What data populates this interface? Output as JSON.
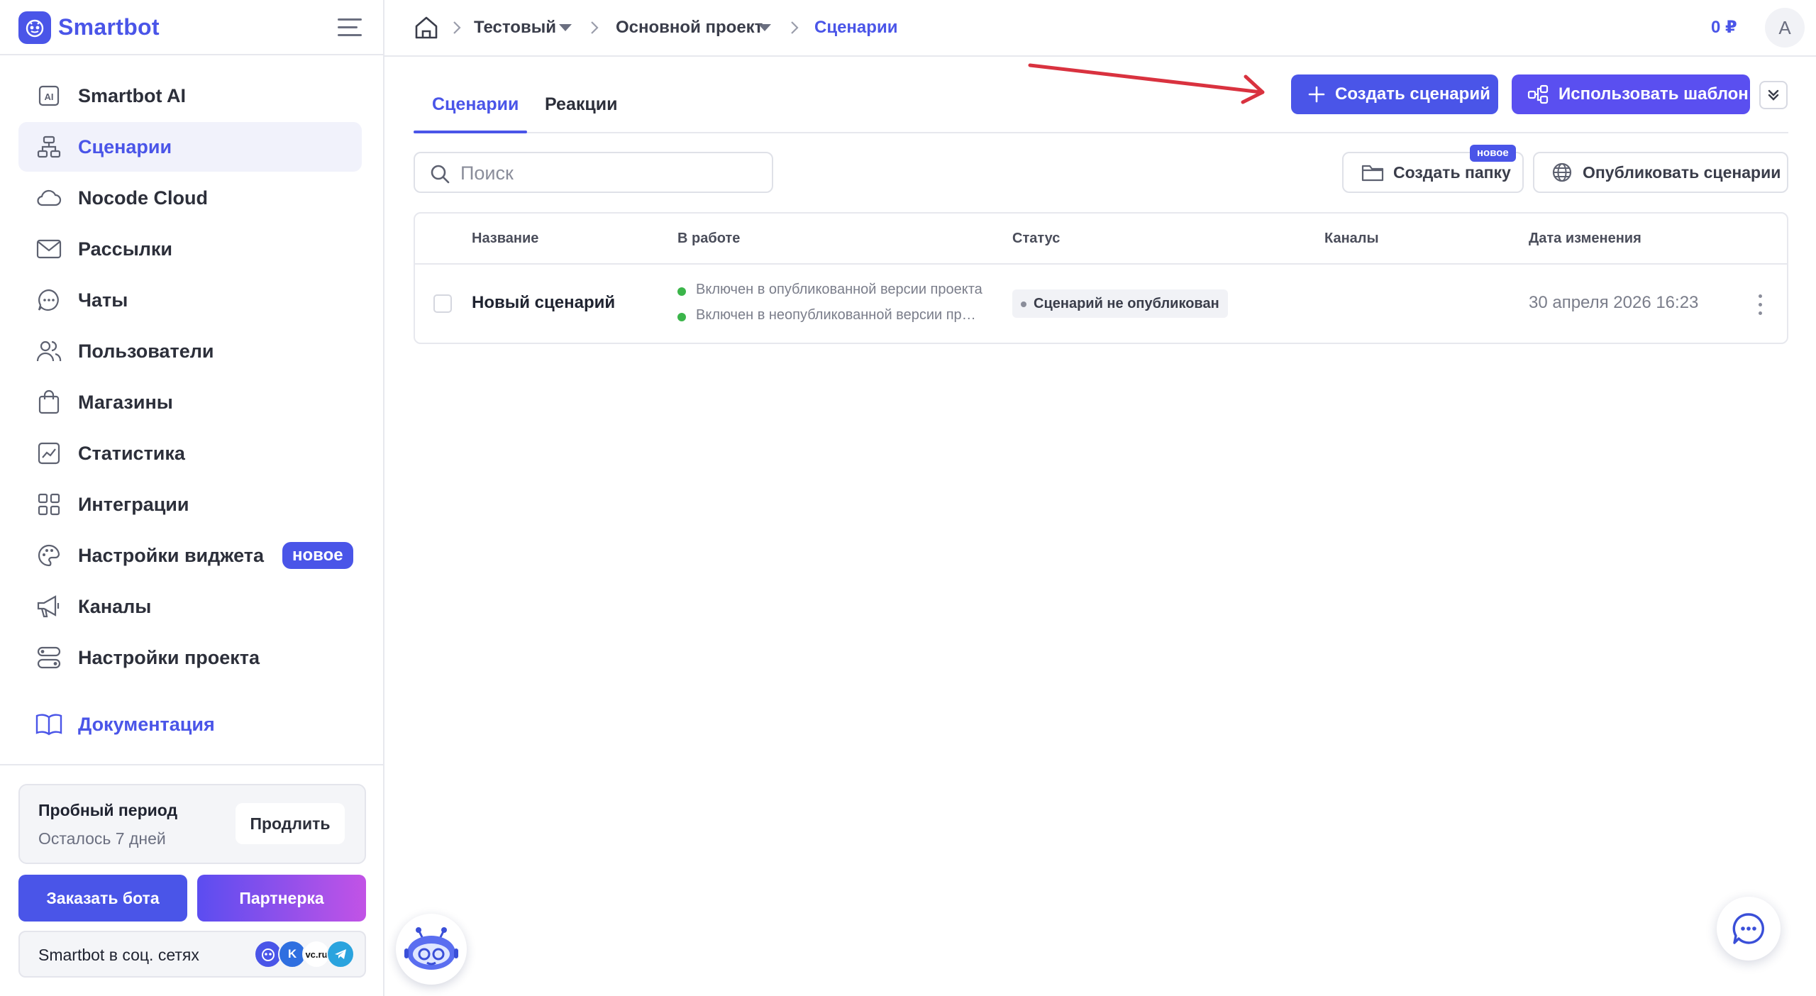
{
  "app": {
    "name": "Smartbot"
  },
  "sidebar": {
    "items": [
      {
        "label": "Smartbot AI",
        "icon": "ai-icon"
      },
      {
        "label": "Сценарии",
        "icon": "flow-icon",
        "active": true
      },
      {
        "label": "Nocode Cloud",
        "icon": "cloud-icon"
      },
      {
        "label": "Рассылки",
        "icon": "mail-icon"
      },
      {
        "label": "Чаты",
        "icon": "chat-icon"
      },
      {
        "label": "Пользователи",
        "icon": "users-icon"
      },
      {
        "label": "Магазины",
        "icon": "bag-icon"
      },
      {
        "label": "Статистика",
        "icon": "chart-icon"
      },
      {
        "label": "Интеграции",
        "icon": "grid-icon"
      },
      {
        "label": "Настройки виджета",
        "icon": "palette-icon",
        "badge": "новое"
      },
      {
        "label": "Каналы",
        "icon": "megaphone-icon"
      },
      {
        "label": "Настройки проекта",
        "icon": "settings-icon"
      }
    ],
    "docs_label": "Документация",
    "trial": {
      "title": "Пробный период",
      "subtitle": "Осталось 7 дней",
      "extend_label": "Продлить"
    },
    "order_label": "Заказать бота",
    "partner_label": "Партнерка",
    "social": {
      "label": "Smartbot в соц. сетях",
      "icons": [
        "smartbot-icon",
        "vk-icon",
        "vc-icon",
        "telegram-icon"
      ],
      "vc_text": "vc.ru"
    }
  },
  "topbar": {
    "breadcrumb": [
      "Тестовый",
      "Основной проект",
      "Сценарии"
    ],
    "balance": "0 ₽",
    "avatar_letter": "A"
  },
  "main": {
    "tabs": [
      {
        "label": "Сценарии",
        "active": true
      },
      {
        "label": "Реакции",
        "active": false
      }
    ],
    "create_label": "Создать сценарий",
    "template_label": "Использовать шаблон",
    "search_placeholder": "Поиск",
    "create_folder_label": "Создать папку",
    "new_badge": "новое",
    "publish_label": "Опубликовать сценарии",
    "table": {
      "columns": [
        "Название",
        "В работе",
        "Статус",
        "Каналы",
        "Дата изменения"
      ],
      "rows": [
        {
          "name": "Новый сценарий",
          "work": [
            "Включен в опубликованной версии проекта",
            "Включен в неопубликованной версии проекта"
          ],
          "status": "Сценарий не опубликован",
          "channels": "",
          "date": "30 апреля 2026 16:23"
        }
      ]
    }
  },
  "colors": {
    "accent": "#4a55e8",
    "annotation_arrow": "#d9323f",
    "active_dot": "#3bb54a"
  }
}
